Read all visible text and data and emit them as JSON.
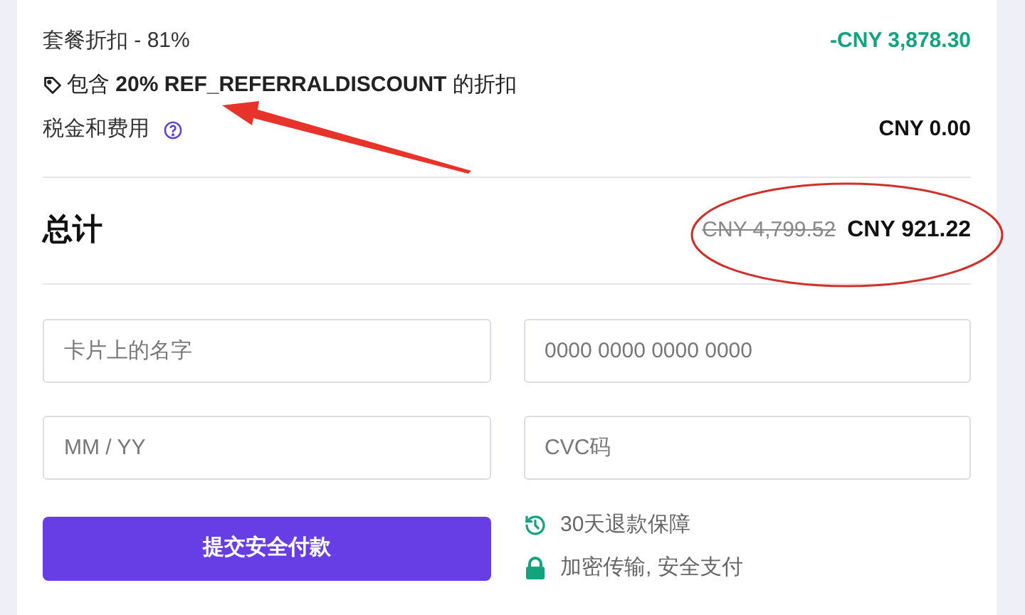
{
  "summary": {
    "discount": {
      "label": "套餐折扣 - 81%",
      "amount": "-CNY 3,878.30"
    },
    "promo_note": "包含 **20% REF_REFERRALDISCOUNT** 的折扣",
    "tax": {
      "label": "税金和费用",
      "amount": "CNY 0.00"
    }
  },
  "total": {
    "label": "总计",
    "original": "CNY 4,799.52",
    "amount": "CNY 921.22"
  },
  "fields": [
    {
      "placeholder": "卡片上的名字"
    },
    {
      "placeholder": "0000 0000 0000 0000"
    },
    {
      "placeholder": "MM / YY"
    },
    {
      "placeholder": "CVC码"
    }
  ],
  "submit_button": "提交安全付款",
  "assurances": [
    {
      "kind": "refund",
      "text": "30天退款保障"
    },
    {
      "kind": "secure",
      "text": "加密传输, 安全支付"
    }
  ]
}
